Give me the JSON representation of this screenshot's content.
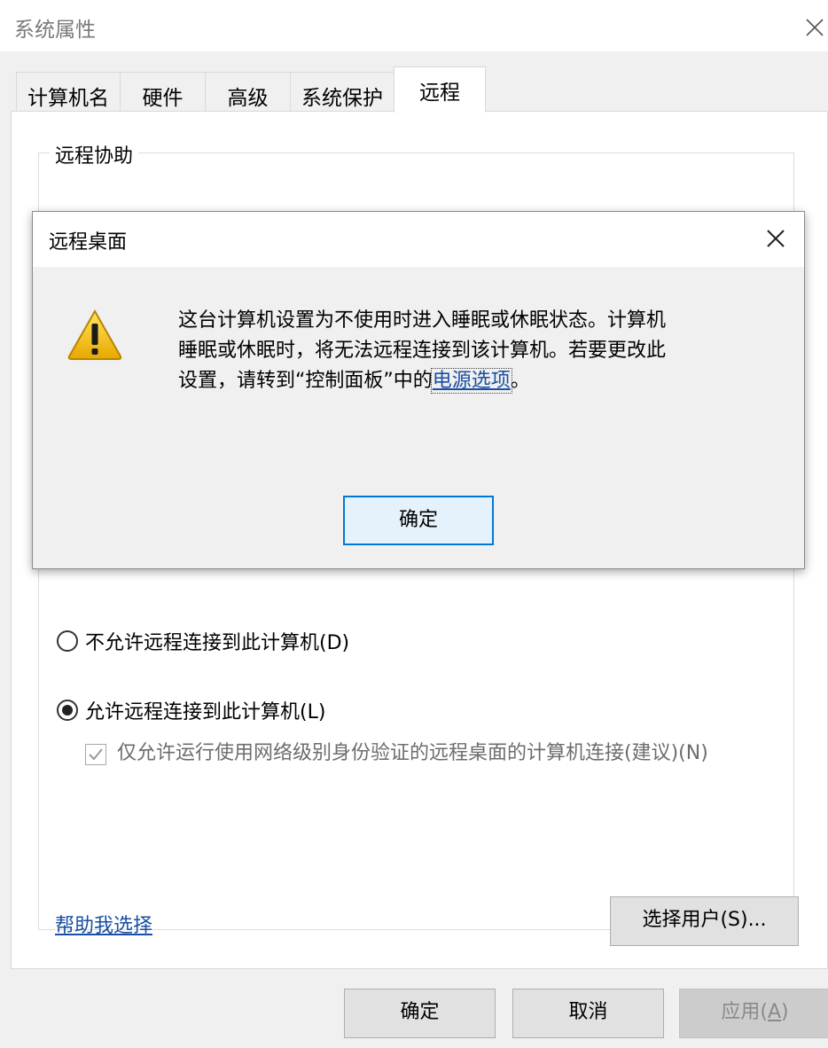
{
  "window": {
    "title": "系统属性",
    "close_icon": "close-icon"
  },
  "tabs": [
    {
      "label": "计算机名"
    },
    {
      "label": "硬件"
    },
    {
      "label": "高级"
    },
    {
      "label": "系统保护"
    },
    {
      "label": "远程",
      "active": true
    }
  ],
  "remote_assistance": {
    "group_label": "远程协助"
  },
  "remote_desktop": {
    "radio_disallow": "不允许远程连接到此计算机(D)",
    "radio_allow": "允许远程连接到此计算机(L)",
    "selected": "allow",
    "nla_checkbox_label": "仅允许运行使用网络级别身份验证的远程桌面的计算机连接(建议)(N)",
    "nla_checked": true,
    "nla_disabled": true,
    "help_link": "帮助我选择",
    "select_users_button": "选择用户(S)..."
  },
  "footer": {
    "ok": "确定",
    "cancel": "取消",
    "apply_prefix": "应用(",
    "apply_accel": "A",
    "apply_suffix": ")"
  },
  "dialog": {
    "title": "远程桌面",
    "message_before_link": "这台计算机设置为不使用时进入睡眠或休眠状态。计算机睡眠或休眠时，将无法远程连接到该计算机。若要更改此设置，请转到“控制面板”中的",
    "message_link": "电源选项",
    "message_after_link": "。",
    "ok_button": "确定",
    "icon": "warning-icon"
  },
  "colors": {
    "link": "#1a4fa3",
    "focus_border": "#0078d7",
    "warning_yellow": "#f5c400"
  }
}
